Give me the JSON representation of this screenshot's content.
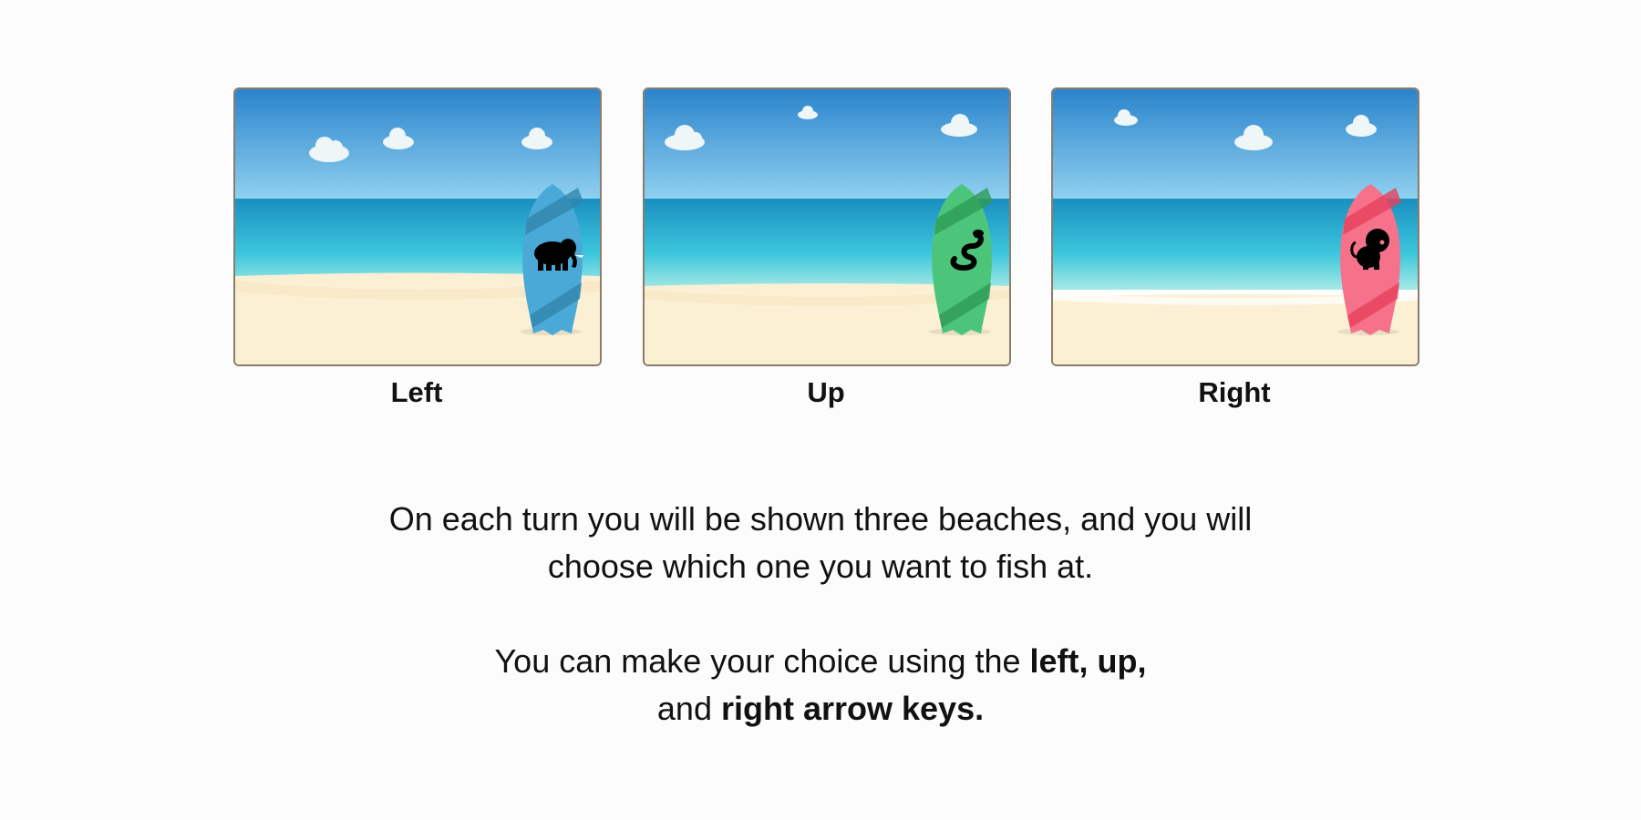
{
  "beaches": [
    {
      "label": "Left",
      "icon": "elephant-icon",
      "board_color": "#4aa9d6",
      "board_stripe": "#2f86ad"
    },
    {
      "label": "Up",
      "icon": "snake-icon",
      "board_color": "#4cc57a",
      "board_stripe": "#2e9a55"
    },
    {
      "label": "Right",
      "icon": "lion-icon",
      "board_color": "#f5728a",
      "board_stripe": "#e8405c"
    }
  ],
  "colors": {
    "sky_top": "#2a84cc",
    "sky_bottom": "#8fd0ef",
    "sea_top": "#1a8fc0",
    "sea_bottom": "#55d4e2",
    "sand": "#fcf0d4",
    "cloud": "#eef6f8"
  },
  "instructions": {
    "line1": "On each turn you will be shown three beaches, and you will",
    "line2": "choose which one you want to fish at.",
    "line3_prefix": "You can make your choice using the ",
    "line3_bold": "left, up,",
    "line4_prefix": "and ",
    "line4_bold": "right arrow keys."
  }
}
